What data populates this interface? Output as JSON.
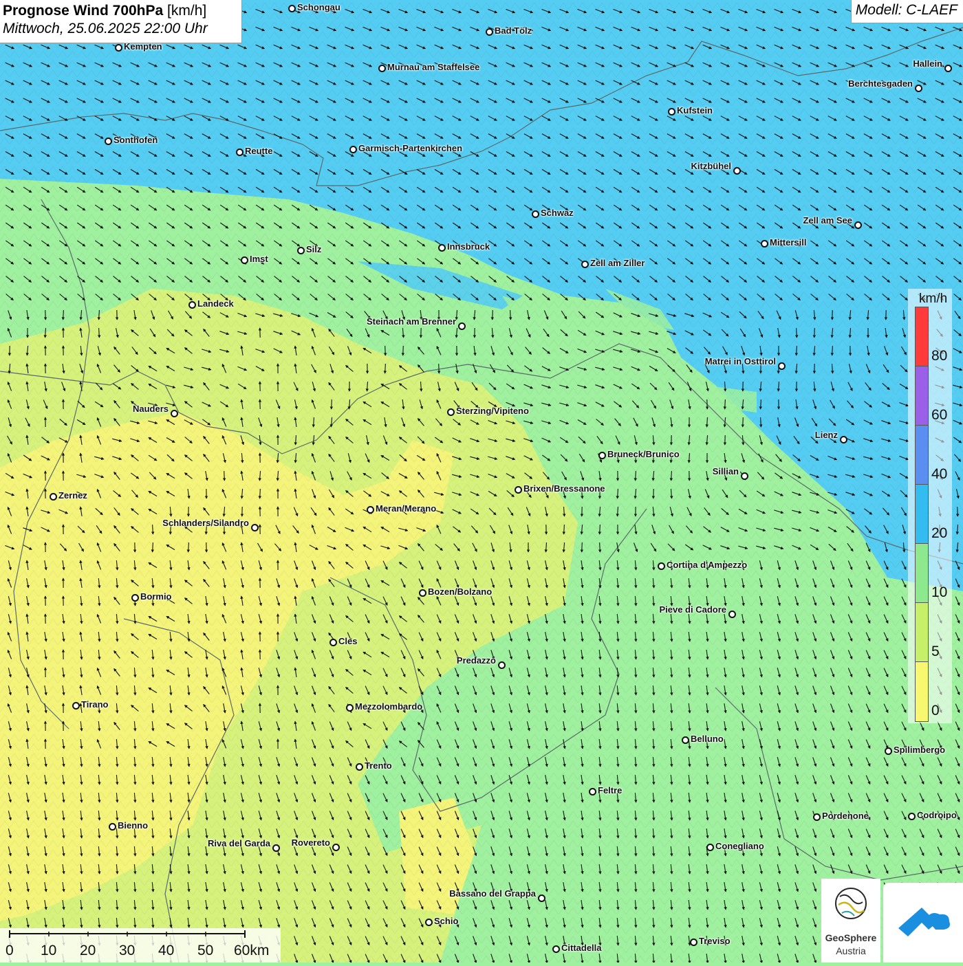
{
  "title": {
    "main_bold": "Prognose Wind 700hPa",
    "main_unit": " [km/h]",
    "subtitle": "Mittwoch, 25.06.2025 22:00 Uhr"
  },
  "model": "Modell: C-LAEF",
  "legend": {
    "unit": "km/h",
    "ticks": [
      "80",
      "60",
      "40",
      "20",
      "10",
      "5",
      "0"
    ],
    "colors": [
      "#ff3a3a",
      "#9a60e8",
      "#5a8ef0",
      "#33bcef",
      "#8ee88e",
      "#c6f06a",
      "#f8f870"
    ]
  },
  "scale_bar": {
    "ticks": [
      "0",
      "10",
      "20",
      "30",
      "40",
      "50",
      "60km"
    ]
  },
  "logos": {
    "geosphere_line1": "GeoSphere",
    "geosphere_line2": "Austria"
  },
  "colors": {
    "wind_strong": "#55cdf2",
    "wind_medium": "#9ff09f",
    "wind_light": "#d6f27c",
    "wind_calm": "#f4f47a",
    "border": "#5a6a6a"
  },
  "cities": [
    {
      "name": "Schongau"
    },
    {
      "name": "Bad Tölz"
    },
    {
      "name": "Kempten"
    },
    {
      "name": "Murnau am Staffelsee"
    },
    {
      "name": "Hallein"
    },
    {
      "name": "Berchtesgaden"
    },
    {
      "name": "Kufstein"
    },
    {
      "name": "Sonthofen"
    },
    {
      "name": "Reutte"
    },
    {
      "name": "Garmisch-Partenkirchen"
    },
    {
      "name": "Kitzbühel"
    },
    {
      "name": "Schwaz"
    },
    {
      "name": "Zell am See"
    },
    {
      "name": "Mittersill"
    },
    {
      "name": "Innsbruck"
    },
    {
      "name": "Silz"
    },
    {
      "name": "Imst"
    },
    {
      "name": "Zell am Ziller"
    },
    {
      "name": "Landeck"
    },
    {
      "name": "Steinach am Brenner"
    },
    {
      "name": "Matrei in Osttirol"
    },
    {
      "name": "Nauders"
    },
    {
      "name": "Sterzing/Vipiteno"
    },
    {
      "name": "Lienz"
    },
    {
      "name": "Bruneck/Brunico"
    },
    {
      "name": "Sillian"
    },
    {
      "name": "Brixen/Bressanone"
    },
    {
      "name": "Zernez"
    },
    {
      "name": "Meran/Merano"
    },
    {
      "name": "Schlanders/Silandro"
    },
    {
      "name": "Cortina d'Ampezzo"
    },
    {
      "name": "Bozen/Bolzano"
    },
    {
      "name": "Bormio"
    },
    {
      "name": "Pieve di Cadore"
    },
    {
      "name": "Cles"
    },
    {
      "name": "Predazzo"
    },
    {
      "name": "Tirano"
    },
    {
      "name": "Mezzolombardo"
    },
    {
      "name": "Belluno"
    },
    {
      "name": "Spilimbergo"
    },
    {
      "name": "Trento"
    },
    {
      "name": "Feltre"
    },
    {
      "name": "Pordenone"
    },
    {
      "name": "Codroipo"
    },
    {
      "name": "Bienno"
    },
    {
      "name": "Riva del Garda"
    },
    {
      "name": "Rovereto"
    },
    {
      "name": "Conegliano"
    },
    {
      "name": "Bassano del Grappa"
    },
    {
      "name": "Schio"
    },
    {
      "name": "Treviso"
    },
    {
      "name": "Cittadella"
    }
  ]
}
